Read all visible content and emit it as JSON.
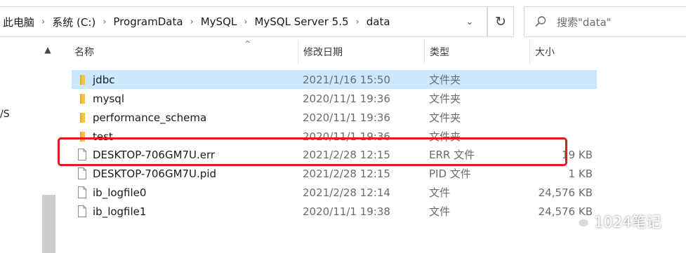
{
  "address_bar": {
    "breadcrumbs": [
      "此电脑",
      "系统 (C:)",
      "ProgramData",
      "MySQL",
      "MySQL Server 5.5",
      "data"
    ]
  },
  "search": {
    "placeholder": "搜索\"data\""
  },
  "nav_pane": {
    "partial_label": "/S"
  },
  "columns": {
    "name": "名称",
    "date": "修改日期",
    "type": "类型",
    "size": "大小"
  },
  "files": [
    {
      "name": "jdbc",
      "date": "2021/1/16 15:50",
      "type": "文件夹",
      "size": "",
      "icon": "folder-icon",
      "selected": true
    },
    {
      "name": "mysql",
      "date": "2020/11/1 19:36",
      "type": "文件夹",
      "size": "",
      "icon": "folder-icon",
      "selected": false
    },
    {
      "name": "performance_schema",
      "date": "2020/11/1 19:36",
      "type": "文件夹",
      "size": "",
      "icon": "folder-icon",
      "selected": false
    },
    {
      "name": "test",
      "date": "2020/11/1 19:36",
      "type": "文件夹",
      "size": "",
      "icon": "folder-icon",
      "selected": false
    },
    {
      "name": "DESKTOP-706GM7U.err",
      "date": "2021/2/28 12:15",
      "type": "ERR 文件",
      "size": "19 KB",
      "icon": "file-icon",
      "selected": false
    },
    {
      "name": "DESKTOP-706GM7U.pid",
      "date": "2021/2/28 12:15",
      "type": "PID 文件",
      "size": "1 KB",
      "icon": "file-icon",
      "selected": false
    },
    {
      "name": "ib_logfile0",
      "date": "2021/2/28 12:14",
      "type": "文件",
      "size": "24,576 KB",
      "icon": "file-icon",
      "selected": false
    },
    {
      "name": "ib_logfile1",
      "date": "2020/11/1 19:38",
      "type": "文件",
      "size": "24,576 KB",
      "icon": "file-icon",
      "selected": false
    }
  ],
  "highlight": {
    "color": "#e11a1a",
    "target_row": 4
  },
  "watermark": {
    "text": "1024笔记"
  },
  "colors": {
    "selection": "#cce8ff",
    "folder": "#f5c342"
  }
}
